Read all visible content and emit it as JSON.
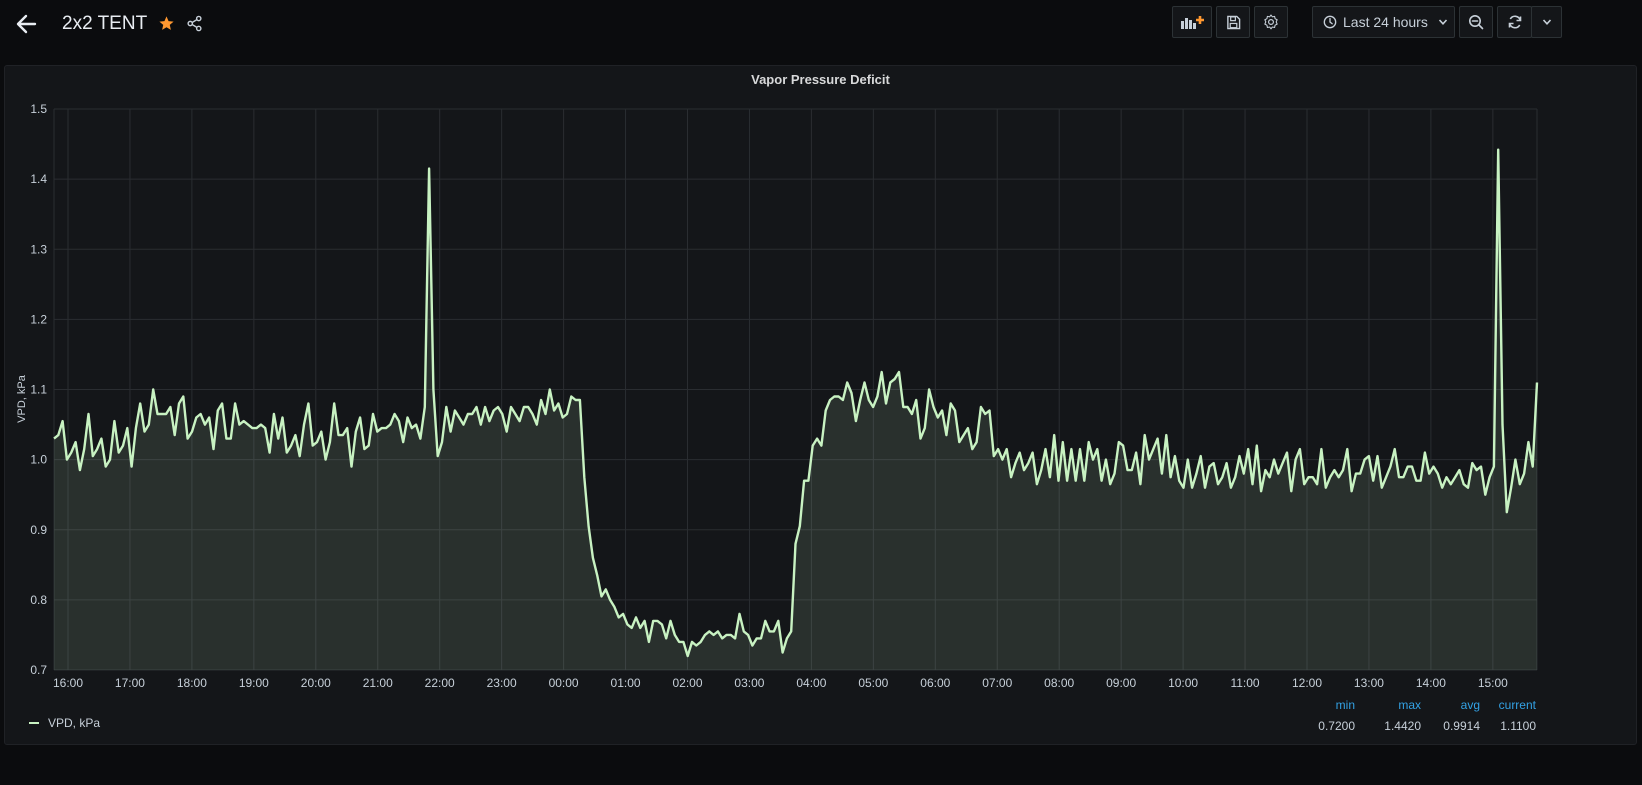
{
  "header": {
    "title": "2x2 TENT",
    "starred": true,
    "time_range_label": "Last 24 hours",
    "accent_star_color": "#ff9830"
  },
  "toolbar": {
    "icons": [
      "add-panel-icon",
      "save-icon",
      "settings-icon",
      "clock-icon",
      "chevron-down-icon",
      "zoom-out-icon",
      "refresh-icon",
      "chevron-down-icon"
    ]
  },
  "panel": {
    "title": "Vapor Pressure Deficit"
  },
  "legend": {
    "series_name": "VPD, kPa",
    "headers": {
      "min": "min",
      "max": "max",
      "avg": "avg",
      "current": "current"
    },
    "values": {
      "min": "0.7200",
      "max": "1.4420",
      "avg": "0.9914",
      "current": "1.1100"
    }
  },
  "chart_data": {
    "type": "area",
    "title": "Vapor Pressure Deficit",
    "xlabel": "",
    "ylabel": "VPD, kPa",
    "ylim": [
      0.7,
      1.5
    ],
    "yticks": [
      "0.7",
      "0.8",
      "0.9",
      "1.0",
      "1.1",
      "1.2",
      "1.3",
      "1.4",
      "1.5"
    ],
    "xticks": [
      "16:00",
      "17:00",
      "18:00",
      "19:00",
      "20:00",
      "21:00",
      "22:00",
      "23:00",
      "00:00",
      "01:00",
      "02:00",
      "03:00",
      "04:00",
      "05:00",
      "06:00",
      "07:00",
      "08:00",
      "09:00",
      "10:00",
      "11:00",
      "12:00",
      "13:00",
      "14:00",
      "15:00"
    ],
    "grid": true,
    "legend_position": "bottom-left",
    "line_color": "#c8f2c2",
    "series": [
      {
        "name": "VPD, kPa",
        "values": [
          1.03,
          1.035,
          1.055,
          1.0,
          1.01,
          1.025,
          0.985,
          1.015,
          1.065,
          1.005,
          1.015,
          1.03,
          0.99,
          1.0,
          1.055,
          1.01,
          1.02,
          1.045,
          0.99,
          1.045,
          1.08,
          1.04,
          1.05,
          1.1,
          1.065,
          1.065,
          1.065,
          1.075,
          1.035,
          1.08,
          1.09,
          1.03,
          1.04,
          1.06,
          1.065,
          1.05,
          1.06,
          1.015,
          1.07,
          1.08,
          1.03,
          1.03,
          1.08,
          1.05,
          1.055,
          1.05,
          1.045,
          1.045,
          1.05,
          1.045,
          1.01,
          1.065,
          1.03,
          1.06,
          1.01,
          1.02,
          1.035,
          1.005,
          1.05,
          1.08,
          1.02,
          1.025,
          1.04,
          1.0,
          1.025,
          1.08,
          1.035,
          1.035,
          1.045,
          0.99,
          1.04,
          1.06,
          1.015,
          1.02,
          1.065,
          1.04,
          1.045,
          1.045,
          1.05,
          1.065,
          1.055,
          1.025,
          1.06,
          1.045,
          1.05,
          1.03,
          1.075,
          1.415,
          1.1,
          1.005,
          1.025,
          1.075,
          1.04,
          1.07,
          1.06,
          1.05,
          1.065,
          1.065,
          1.075,
          1.05,
          1.075,
          1.055,
          1.07,
          1.075,
          1.065,
          1.04,
          1.075,
          1.065,
          1.055,
          1.075,
          1.075,
          1.065,
          1.05,
          1.085,
          1.065,
          1.1,
          1.07,
          1.08,
          1.06,
          1.065,
          1.09,
          1.085,
          1.085,
          0.975,
          0.905,
          0.86,
          0.835,
          0.805,
          0.815,
          0.8,
          0.79,
          0.775,
          0.78,
          0.765,
          0.76,
          0.775,
          0.76,
          0.77,
          0.74,
          0.77,
          0.77,
          0.765,
          0.745,
          0.77,
          0.75,
          0.74,
          0.74,
          0.72,
          0.74,
          0.735,
          0.74,
          0.75,
          0.755,
          0.75,
          0.755,
          0.745,
          0.75,
          0.75,
          0.745,
          0.78,
          0.755,
          0.75,
          0.735,
          0.745,
          0.745,
          0.77,
          0.755,
          0.755,
          0.77,
          0.725,
          0.745,
          0.755,
          0.88,
          0.905,
          0.97,
          0.97,
          1.02,
          1.03,
          1.02,
          1.07,
          1.085,
          1.09,
          1.09,
          1.085,
          1.11,
          1.095,
          1.055,
          1.085,
          1.11,
          1.085,
          1.075,
          1.09,
          1.125,
          1.08,
          1.11,
          1.115,
          1.125,
          1.075,
          1.075,
          1.065,
          1.085,
          1.03,
          1.045,
          1.1,
          1.075,
          1.06,
          1.07,
          1.035,
          1.08,
          1.07,
          1.025,
          1.035,
          1.045,
          1.015,
          1.025,
          1.075,
          1.065,
          1.07,
          1.005,
          1.015,
          1.0,
          1.015,
          0.975,
          0.995,
          1.01,
          0.985,
          0.995,
          1.01,
          0.965,
          0.985,
          1.015,
          0.975,
          1.035,
          0.97,
          1.025,
          0.97,
          1.015,
          0.97,
          1.015,
          0.97,
          1.025,
          1.0,
          1.015,
          0.97,
          1.0,
          0.965,
          0.98,
          1.025,
          1.02,
          0.985,
          0.985,
          1.01,
          0.965,
          1.035,
          1.0,
          1.015,
          1.03,
          0.98,
          1.035,
          0.975,
          1.005,
          0.97,
          0.96,
          1.0,
          0.96,
          0.98,
          1.005,
          0.96,
          0.99,
          0.995,
          0.965,
          0.975,
          0.995,
          0.96,
          0.975,
          1.005,
          0.98,
          1.015,
          0.965,
          1.02,
          0.955,
          0.985,
          0.975,
          1.0,
          0.98,
          0.995,
          1.01,
          0.955,
          1.0,
          1.015,
          0.965,
          0.975,
          0.975,
          0.965,
          1.015,
          0.96,
          0.975,
          0.985,
          0.975,
          0.985,
          1.015,
          0.955,
          0.98,
          0.98,
          1.0,
          1.005,
          0.97,
          1.005,
          0.96,
          0.975,
          0.99,
          1.015,
          0.975,
          0.975,
          0.99,
          0.99,
          0.97,
          0.97,
          1.01,
          0.98,
          0.99,
          0.98,
          0.96,
          0.975,
          0.965,
          0.975,
          0.985,
          0.965,
          0.96,
          0.995,
          0.985,
          0.99,
          0.95,
          0.975,
          0.99,
          1.442,
          1.05,
          0.925,
          0.96,
          1.0,
          0.965,
          0.98,
          1.025,
          0.99,
          1.11
        ]
      }
    ]
  }
}
